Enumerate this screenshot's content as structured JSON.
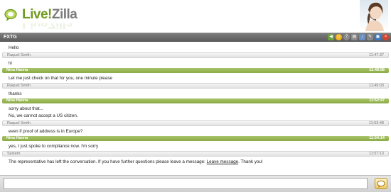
{
  "header": {
    "logo_main": "Live",
    "logo_mark": "Zilla",
    "logo_full": "LiveZilla",
    "brand_color": "#6e9a1e"
  },
  "topbar": {
    "title": "FXTG",
    "tool_icons": [
      "back-icon",
      "smiley-icon",
      "help-icon",
      "print-icon",
      "sound-icon",
      "edit-icon",
      "save-icon",
      "close-icon"
    ]
  },
  "messages": [
    {
      "type": "visitor",
      "name": "",
      "time": "",
      "text": "Hello"
    },
    {
      "type": "visitor",
      "name": "Raquel Smith",
      "time": "11:47:37",
      "text": "hi"
    },
    {
      "type": "operator",
      "name": "Nina Hanna",
      "time": "11:48:58",
      "text": "Let me just check on that for you, one minute please"
    },
    {
      "type": "visitor",
      "name": "Raquel Smith",
      "time": "11:49:03",
      "text": "thanks"
    },
    {
      "type": "operator",
      "name": "Nina Hanna",
      "time": "11:52:47",
      "text": "sorry about that..."
    },
    {
      "type": "continue",
      "name": "",
      "time": "",
      "text": "No, we cannot accept a US citizen."
    },
    {
      "type": "visitor",
      "name": "Raquel Smith",
      "time": "11:53:48",
      "text": "even if proof of address is in Europe?"
    },
    {
      "type": "operator",
      "name": "Nina Hanna",
      "time": "11:54:14",
      "text": "yes, I just spoke to compliance now. I'm sorry"
    },
    {
      "type": "visitor",
      "name": "System",
      "time": "11:57:13",
      "text": "The representative has left the conversation. If you have further questions please leave a message:",
      "link": "Leave message",
      "text_after": ". Thank you!"
    }
  ],
  "colors": {
    "operator_header": "#8bab45",
    "topbar": "#5a5a5a"
  }
}
